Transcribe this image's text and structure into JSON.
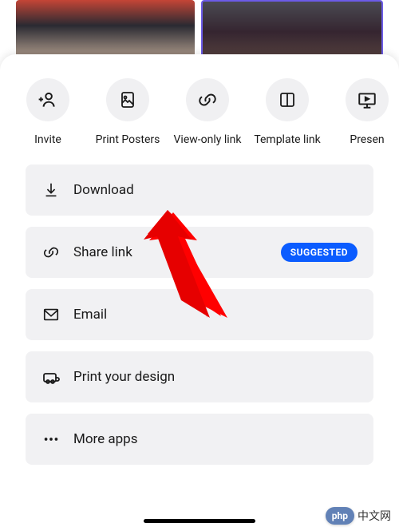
{
  "share": {
    "items": [
      {
        "label": "Invite",
        "icon": "invite-icon"
      },
      {
        "label": "Print Posters",
        "icon": "print-icon"
      },
      {
        "label": "View-only link",
        "icon": "link-icon"
      },
      {
        "label": "Template link",
        "icon": "template-icon"
      },
      {
        "label": "Presen",
        "icon": "present-icon"
      }
    ]
  },
  "list": {
    "items": [
      {
        "label": "Download",
        "icon": "download-icon",
        "badge": null
      },
      {
        "label": "Share link",
        "icon": "share-link-icon",
        "badge": "SUGGESTED"
      },
      {
        "label": "Email",
        "icon": "email-icon",
        "badge": null
      },
      {
        "label": "Print your design",
        "icon": "print-design-icon",
        "badge": null
      },
      {
        "label": "More apps",
        "icon": "more-icon",
        "badge": null
      }
    ]
  },
  "watermark": {
    "badge": "php",
    "text": "中文网"
  }
}
